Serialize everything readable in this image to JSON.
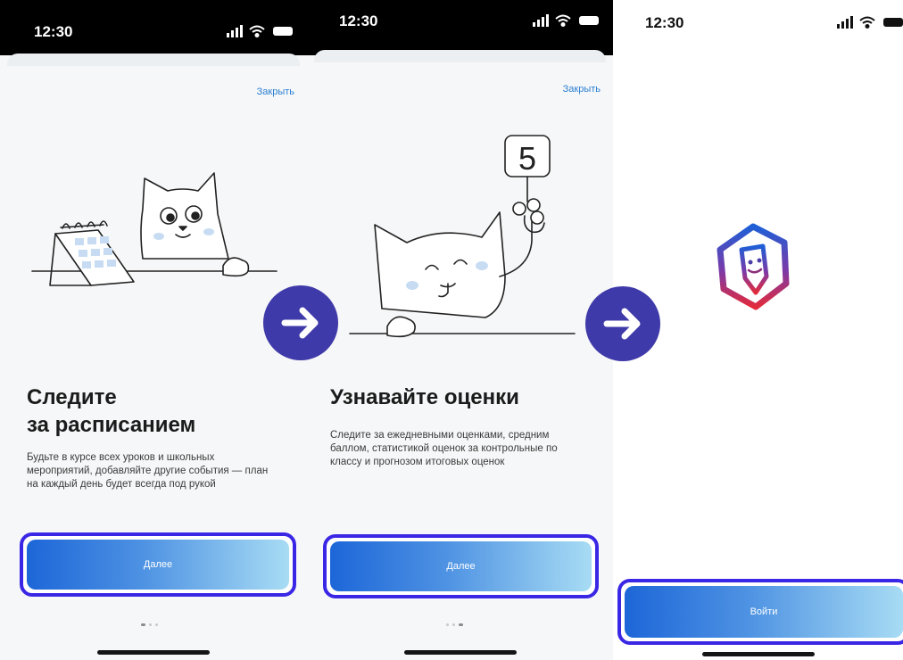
{
  "status_bar": {
    "time": "12:30"
  },
  "screen1": {
    "close_label": "Закрыть",
    "title_line1": "Следите",
    "title_line2": "за расписанием",
    "description": "Будьте в курсе всех уроков и школьных мероприятий, добавляйте другие события — план на каждый день будет всегда под рукой",
    "button_label": "Далее"
  },
  "screen2": {
    "close_label": "Закрыть",
    "title": "Узнавайте оценки",
    "description": "Следите за ежедневными оценками, средним баллом, статистикой оценок за контрольные по классу и прогнозом итоговых оценок",
    "button_label": "Далее",
    "sign_number": "5"
  },
  "screen3": {
    "button_label": "Войти"
  },
  "colors": {
    "highlight": "#3a27e5",
    "arrow_circle": "#3f3aa9",
    "button_gradient": [
      "#1d66d8",
      "#a8dcf4"
    ],
    "link": "#2a7fd4"
  },
  "icons": [
    "signal-icon",
    "wifi-icon",
    "battery-icon",
    "arrow-right-icon",
    "app-logo-icon"
  ]
}
